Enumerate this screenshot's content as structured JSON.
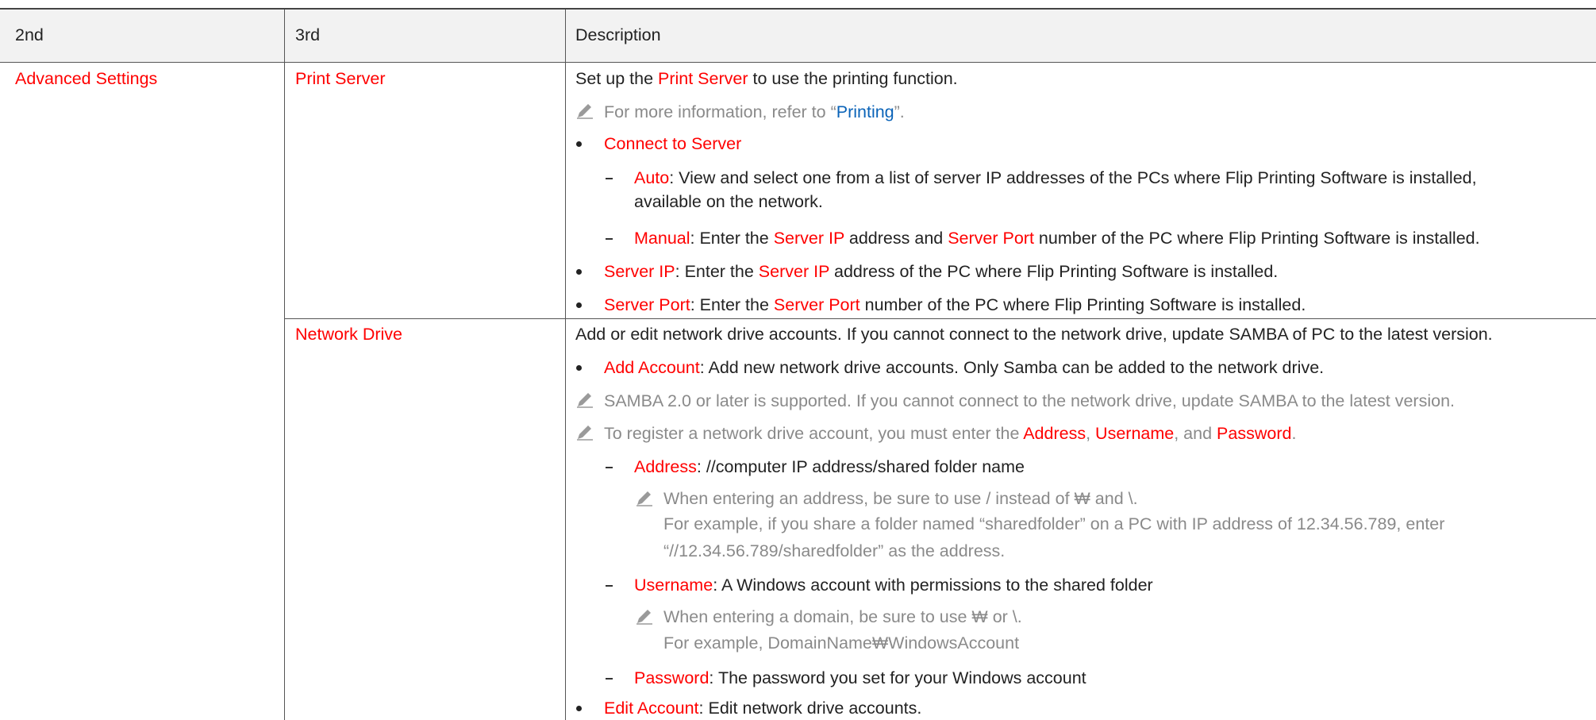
{
  "table": {
    "headers": [
      "2nd",
      "3rd",
      "Description"
    ],
    "col2": "Advanced Settings",
    "print_server": {
      "name": "Print Server",
      "intro": {
        "a": "Set up the ",
        "b": "Print Server",
        "c": " to use the printing function."
      },
      "note": {
        "a": "For more information, refer to “",
        "b": "Printing",
        "c": "”."
      },
      "connect": "Connect to Server",
      "auto": {
        "key": "Auto",
        "a": ": View and select one from a list of server IP addresses of the PCs where ",
        "b": "Flip Printing Software",
        "c": " is installed,",
        "d": "available on the network."
      },
      "manual": {
        "key": "Manual",
        "a": ": Enter the ",
        "b": "Server IP",
        "c": " address and ",
        "d": "Server Port",
        "e": " number of the PC where ",
        "f": "Flip Printing Software",
        "g": " is installed."
      },
      "server_ip": {
        "key": "Server IP",
        "a": ": Enter the ",
        "b": "Server IP",
        "c": " address of the PC where ",
        "d": "Flip Printing Software",
        "e": " is installed."
      },
      "server_port": {
        "key": "Server Port",
        "a": ": Enter the ",
        "b": "Server Port",
        "c": " number of the PC where ",
        "d": "Flip Printing Software",
        "e": " is installed."
      }
    },
    "network_drive": {
      "name": "Network Drive",
      "intro": "Add or edit network drive accounts. If you cannot connect to the network drive, update SAMBA of PC to the latest version.",
      "add": {
        "key": "Add Account",
        "text": ": Add new network drive accounts. Only Samba can be added to the network drive."
      },
      "note1": "SAMBA 2.0 or later is supported. If you cannot connect to the network drive, update SAMBA to the latest version.",
      "note2": {
        "a": "To register a network drive account, you must enter the ",
        "b": "Address",
        "c": ", ",
        "d": "Username",
        "e": ", and ",
        "f": "Password",
        "g": "."
      },
      "address": {
        "key": "Address",
        "text": ": //computer IP address/shared folder name"
      },
      "address_note": [
        "When entering an address, be sure to use / instead of ₩ and \\.",
        "For example, if you share a folder named “sharedfolder” on a PC with IP address of 12.34.56.789, enter",
        "“//12.34.56.789/sharedfolder” as the address."
      ],
      "username": {
        "key": "Username",
        "text": ": A Windows account with permissions to the shared folder"
      },
      "username_note": [
        "When entering a domain, be sure to use ₩ or \\.",
        "For example, DomainName₩WindowsAccount"
      ],
      "password": {
        "key": "Password",
        "text": ": The password you set for your Windows account"
      },
      "edit": {
        "key": "Edit Account",
        "text": ": Edit network drive accounts."
      }
    }
  },
  "icons": {
    "note": "pencil-note-icon"
  },
  "colors": {
    "highlight": "#ff0000",
    "link": "#0a63b8",
    "note_text": "#8a8a8a",
    "header_bg": "#f2f2f2"
  }
}
